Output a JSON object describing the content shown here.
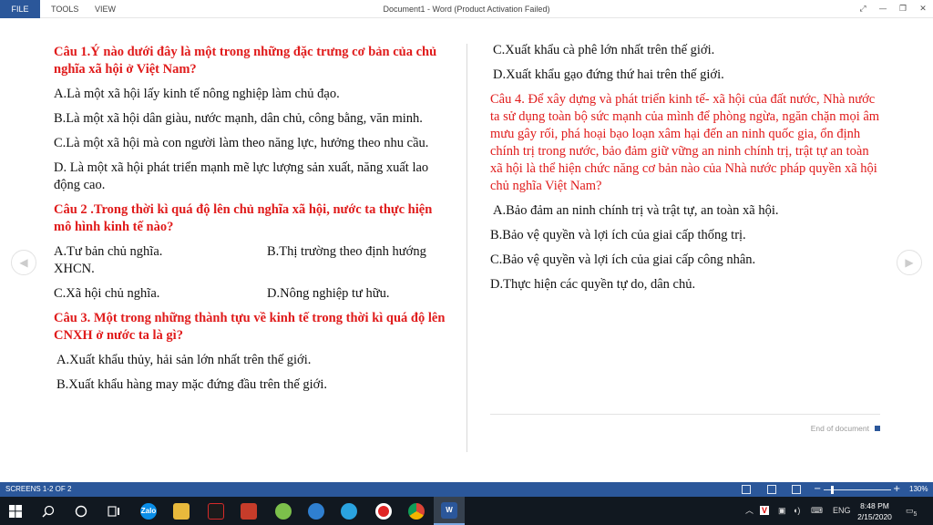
{
  "ribbon": {
    "tabs": [
      "FILE",
      "TOOLS",
      "VIEW"
    ],
    "title": "Document1 - Word (Product Activation Failed)"
  },
  "document": {
    "left": {
      "q1": "Câu 1.Ý nào dưới đây là một trong những đặc trưng cơ bản của chủ nghĩa xã hội ở Việt Nam?",
      "q1_a": "A.Là một xã hội lấy kinh tế nông nghiệp làm chủ đạo.",
      "q1_b": "B.Là một xã hội dân giàu, nước mạnh, dân chủ, công bằng, văn minh.",
      "q1_c": "C.Là một xã hội mà con người làm theo năng lực, hưởng theo nhu cầu.",
      "q1_d": "D. Là một xã hội phát triển mạnh mẽ lực lượng sản xuất, năng xuất lao động cao.",
      "q2": "Câu 2 .Trong thời kì quá độ lên chủ nghĩa xã hội, nước ta thực hiện mô hình kinh tế nào?",
      "q2_a": "A.Tư bản chủ nghĩa.",
      "q2_b1": "B.Thị trường theo định hướng",
      "q2_b2": "XHCN.",
      "q2_c": "C.Xã hội chủ nghĩa.",
      "q2_d": "D.Nông nghiệp tư hữu.",
      "q3": "Câu 3. Một trong những thành tựu về kinh tế trong thời kì quá độ lên CNXH ở nước ta là gì?",
      "q3_a": "A.Xuất khẩu thủy, hải sản lớn nhất trên thế giới.",
      "q3_b": "B.Xuất khẩu hàng may mặc đứng đầu trên thế giới."
    },
    "right": {
      "q3_c": "C.Xuất khẩu cà phê lớn nhất trên thế giới.",
      "q3_d": "D.Xuất khẩu gạo đứng thứ hai trên thế giới.",
      "q4": "Câu 4. Để xây dựng và phát triển kinh tế- xã hội của đất nước, Nhà nước ta sử dụng toàn bộ sức mạnh của mình để phòng ngừa, ngăn chặn mọi âm mưu gây rối, phá hoại bạo loạn xâm hại đến an ninh quốc gia, ổn định chính trị trong nước, bảo đảm giữ vững an ninh chính trị, trật tự an toàn xã hội là thể hiện chức năng cơ bản nào của Nhà nước pháp quyền xã hội chủ nghĩa Việt Nam?",
      "q4_a": "A.Bảo đảm an ninh chính trị và trật tự, an toàn xã hội.",
      "q4_b": "B.Bảo vệ quyền và lợi ích của giai cấp thống trị.",
      "q4_c": "C.Bảo vệ quyền và lợi ích của giai cấp công nhân.",
      "q4_d": "D.Thực hiện các quyền tự do, dân chủ."
    },
    "end_text": "End of document"
  },
  "status": {
    "screens": "SCREENS 1-2 OF 2",
    "zoom": "130%",
    "zoom_level": 0.13
  },
  "taskbar": {
    "lang": "ENG",
    "time": "8:48 PM",
    "date": "2/15/2020",
    "notif_count": "5",
    "apps": [
      "start-icon",
      "search-icon",
      "cortana-icon",
      "task-view-icon",
      "zalo-icon",
      "file-explorer-icon",
      "game-app-icon",
      "unikey-icon",
      "green-app-icon",
      "network-app-icon",
      "telegram-icon",
      "record-icon",
      "chrome-icon",
      "word-icon"
    ],
    "zalo_label": "Zalo",
    "word_label": "W",
    "vi_label": "V"
  },
  "colors": {
    "accent": "#2b579a",
    "question_red": "#e01b1b"
  }
}
